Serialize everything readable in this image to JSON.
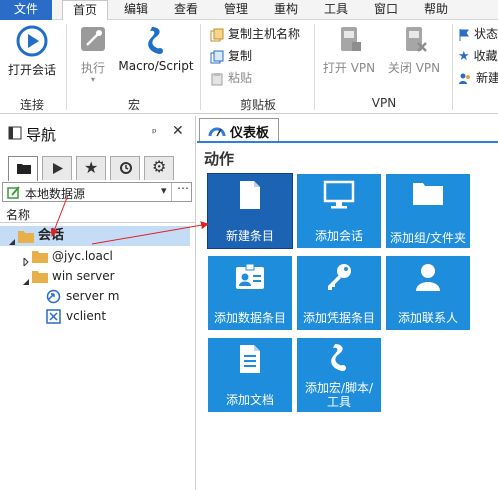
{
  "menu": {
    "file": "文件",
    "items": [
      "首页",
      "编辑",
      "查看",
      "管理",
      "重构",
      "工具",
      "窗口",
      "帮助"
    ]
  },
  "ribbon": {
    "open_session": "打开会话",
    "execute": "执行",
    "macro_script": "Macro/Script",
    "copy_hostname": "复制主机名称",
    "copy": "复制",
    "paste": "粘贴",
    "open_vpn": "打开 VPN",
    "close_vpn": "关闭 VPN",
    "right_items": [
      "状态",
      "收藏",
      "新建"
    ],
    "groups": {
      "connect": "连接",
      "macro": "宏",
      "clipboard": "剪贴板",
      "vpn": "VPN"
    }
  },
  "nav": {
    "title": "导航",
    "datasource": "本地数据源",
    "column_header": "名称",
    "tree": {
      "root": "会话",
      "folder1": "@jyc.loacl",
      "folder2": "win server",
      "item1": "server m",
      "item2": "vclient"
    }
  },
  "dashboard": {
    "tab_label": "仪表板",
    "section_title": "动作",
    "tiles": {
      "new_entry": "新建条目",
      "add_session": "添加会话",
      "add_group": "添加组/文件夹",
      "add_data_entry": "添加数据条目",
      "add_credential": "添加凭据条目",
      "add_contact": "添加联系人",
      "add_document": "添加文档",
      "add_macro": "添加宏/脚本/工具"
    }
  },
  "colors": {
    "accent": "#2a6cc7",
    "tile": "#1e8ddb",
    "tile_selected": "#1d63b3",
    "tree_selected": "#c5dcf6",
    "arrow": "#e02020"
  }
}
